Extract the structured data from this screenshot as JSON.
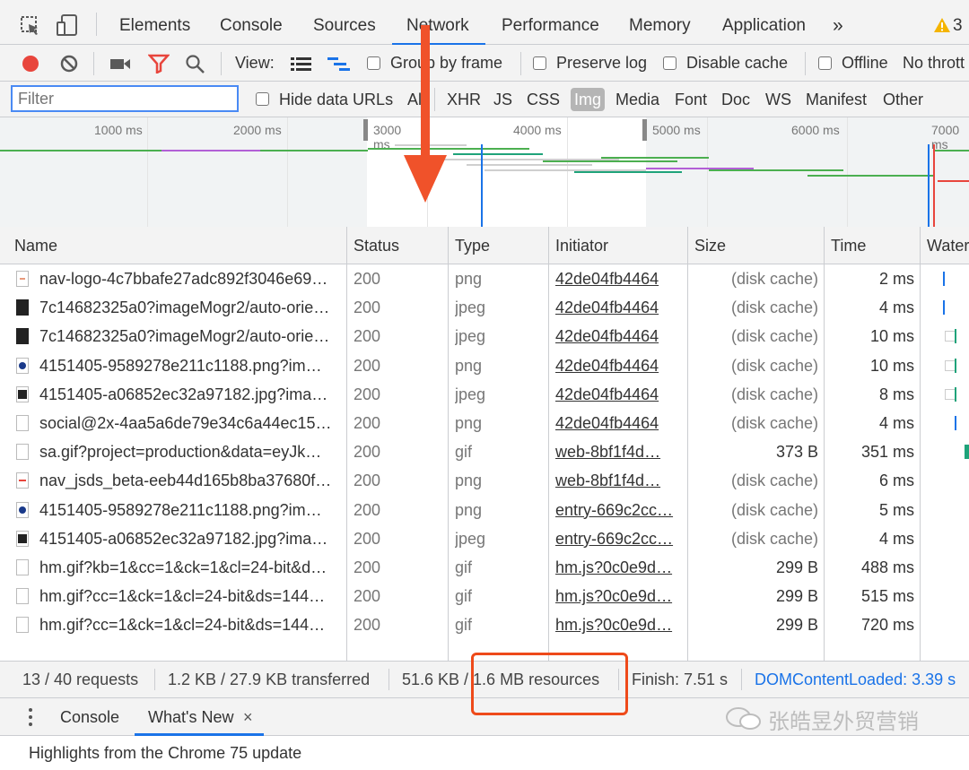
{
  "tabs": {
    "elements": "Elements",
    "console": "Console",
    "sources": "Sources",
    "network": "Network",
    "performance": "Performance",
    "memory": "Memory",
    "application": "Application",
    "more": "»",
    "warnings": "3"
  },
  "toolbar": {
    "view_label": "View:",
    "group_by_frame": "Group by frame",
    "preserve_log": "Preserve log",
    "disable_cache": "Disable cache",
    "offline": "Offline",
    "throttling": "No thrott"
  },
  "filterbar": {
    "placeholder": "Filter",
    "hide_data_urls": "Hide data URLs",
    "types": [
      "All",
      "XHR",
      "JS",
      "CSS",
      "Img",
      "Media",
      "Font",
      "Doc",
      "WS",
      "Manifest",
      "Other"
    ],
    "selected": "Img"
  },
  "overview": {
    "ticks": [
      "1000 ms",
      "2000 ms",
      "3000 ms",
      "4000 ms",
      "5000 ms",
      "6000 ms",
      "7000 ms"
    ]
  },
  "table": {
    "headers": {
      "name": "Name",
      "status": "Status",
      "type": "Type",
      "initiator": "Initiator",
      "size": "Size",
      "time": "Time",
      "waterfall": "Waterfall"
    },
    "rows": [
      {
        "name": "nav-logo-4c7bbafe27adc892f3046e69…",
        "status": "200",
        "type": "png",
        "initiator": "42de04fb4464",
        "size": "(disk cache)",
        "time": "2 ms"
      },
      {
        "name": "7c14682325a0?imageMogr2/auto-orie…",
        "status": "200",
        "type": "jpeg",
        "initiator": "42de04fb4464",
        "size": "(disk cache)",
        "time": "4 ms"
      },
      {
        "name": "7c14682325a0?imageMogr2/auto-orie…",
        "status": "200",
        "type": "jpeg",
        "initiator": "42de04fb4464",
        "size": "(disk cache)",
        "time": "10 ms"
      },
      {
        "name": "4151405-9589278e211c1188.png?im…",
        "status": "200",
        "type": "png",
        "initiator": "42de04fb4464",
        "size": "(disk cache)",
        "time": "10 ms"
      },
      {
        "name": "4151405-a06852ec32a97182.jpg?ima…",
        "status": "200",
        "type": "jpeg",
        "initiator": "42de04fb4464",
        "size": "(disk cache)",
        "time": "8 ms"
      },
      {
        "name": "social@2x-4aa5a6de79e34c6a44ec15…",
        "status": "200",
        "type": "png",
        "initiator": "42de04fb4464",
        "size": "(disk cache)",
        "time": "4 ms"
      },
      {
        "name": "sa.gif?project=production&data=eyJk…",
        "status": "200",
        "type": "gif",
        "initiator": "web-8bf1f4d…",
        "size": "373 B",
        "time": "351 ms"
      },
      {
        "name": "nav_jsds_beta-eeb44d165b8ba37680f…",
        "status": "200",
        "type": "png",
        "initiator": "web-8bf1f4d…",
        "size": "(disk cache)",
        "time": "6 ms"
      },
      {
        "name": "4151405-9589278e211c1188.png?im…",
        "status": "200",
        "type": "png",
        "initiator": "entry-669c2cc…",
        "size": "(disk cache)",
        "time": "5 ms"
      },
      {
        "name": "4151405-a06852ec32a97182.jpg?ima…",
        "status": "200",
        "type": "jpeg",
        "initiator": "entry-669c2cc…",
        "size": "(disk cache)",
        "time": "4 ms"
      },
      {
        "name": "hm.gif?kb=1&cc=1&ck=1&cl=24-bit&d…",
        "status": "200",
        "type": "gif",
        "initiator": "hm.js?0c0e9d…",
        "size": "299 B",
        "time": "488 ms"
      },
      {
        "name": "hm.gif?cc=1&ck=1&cl=24-bit&ds=144…",
        "status": "200",
        "type": "gif",
        "initiator": "hm.js?0c0e9d…",
        "size": "299 B",
        "time": "515 ms"
      },
      {
        "name": "hm.gif?cc=1&ck=1&cl=24-bit&ds=144…",
        "status": "200",
        "type": "gif",
        "initiator": "hm.js?0c0e9d…",
        "size": "299 B",
        "time": "720 ms"
      }
    ]
  },
  "statusbar": {
    "requests": "13 / 40 requests",
    "transferred": "1.2 KB / 27.9 KB transferred",
    "resources": "51.6 KB / 1.6 MB resources",
    "finish": "Finish: 7.51 s",
    "dcl": "DOMContentLoaded: 3.39 s"
  },
  "drawer": {
    "console_tab": "Console",
    "whats_new_tab": "What's New",
    "close": "×",
    "highlights": "Highlights from the Chrome 75 update"
  },
  "watermark": "张皓昱外贸营销",
  "colors": {
    "accent": "#1a73e8",
    "record_red": "#e8453c",
    "annotation": "#ee4a1a",
    "dcl_blue": "#1a73e8"
  }
}
